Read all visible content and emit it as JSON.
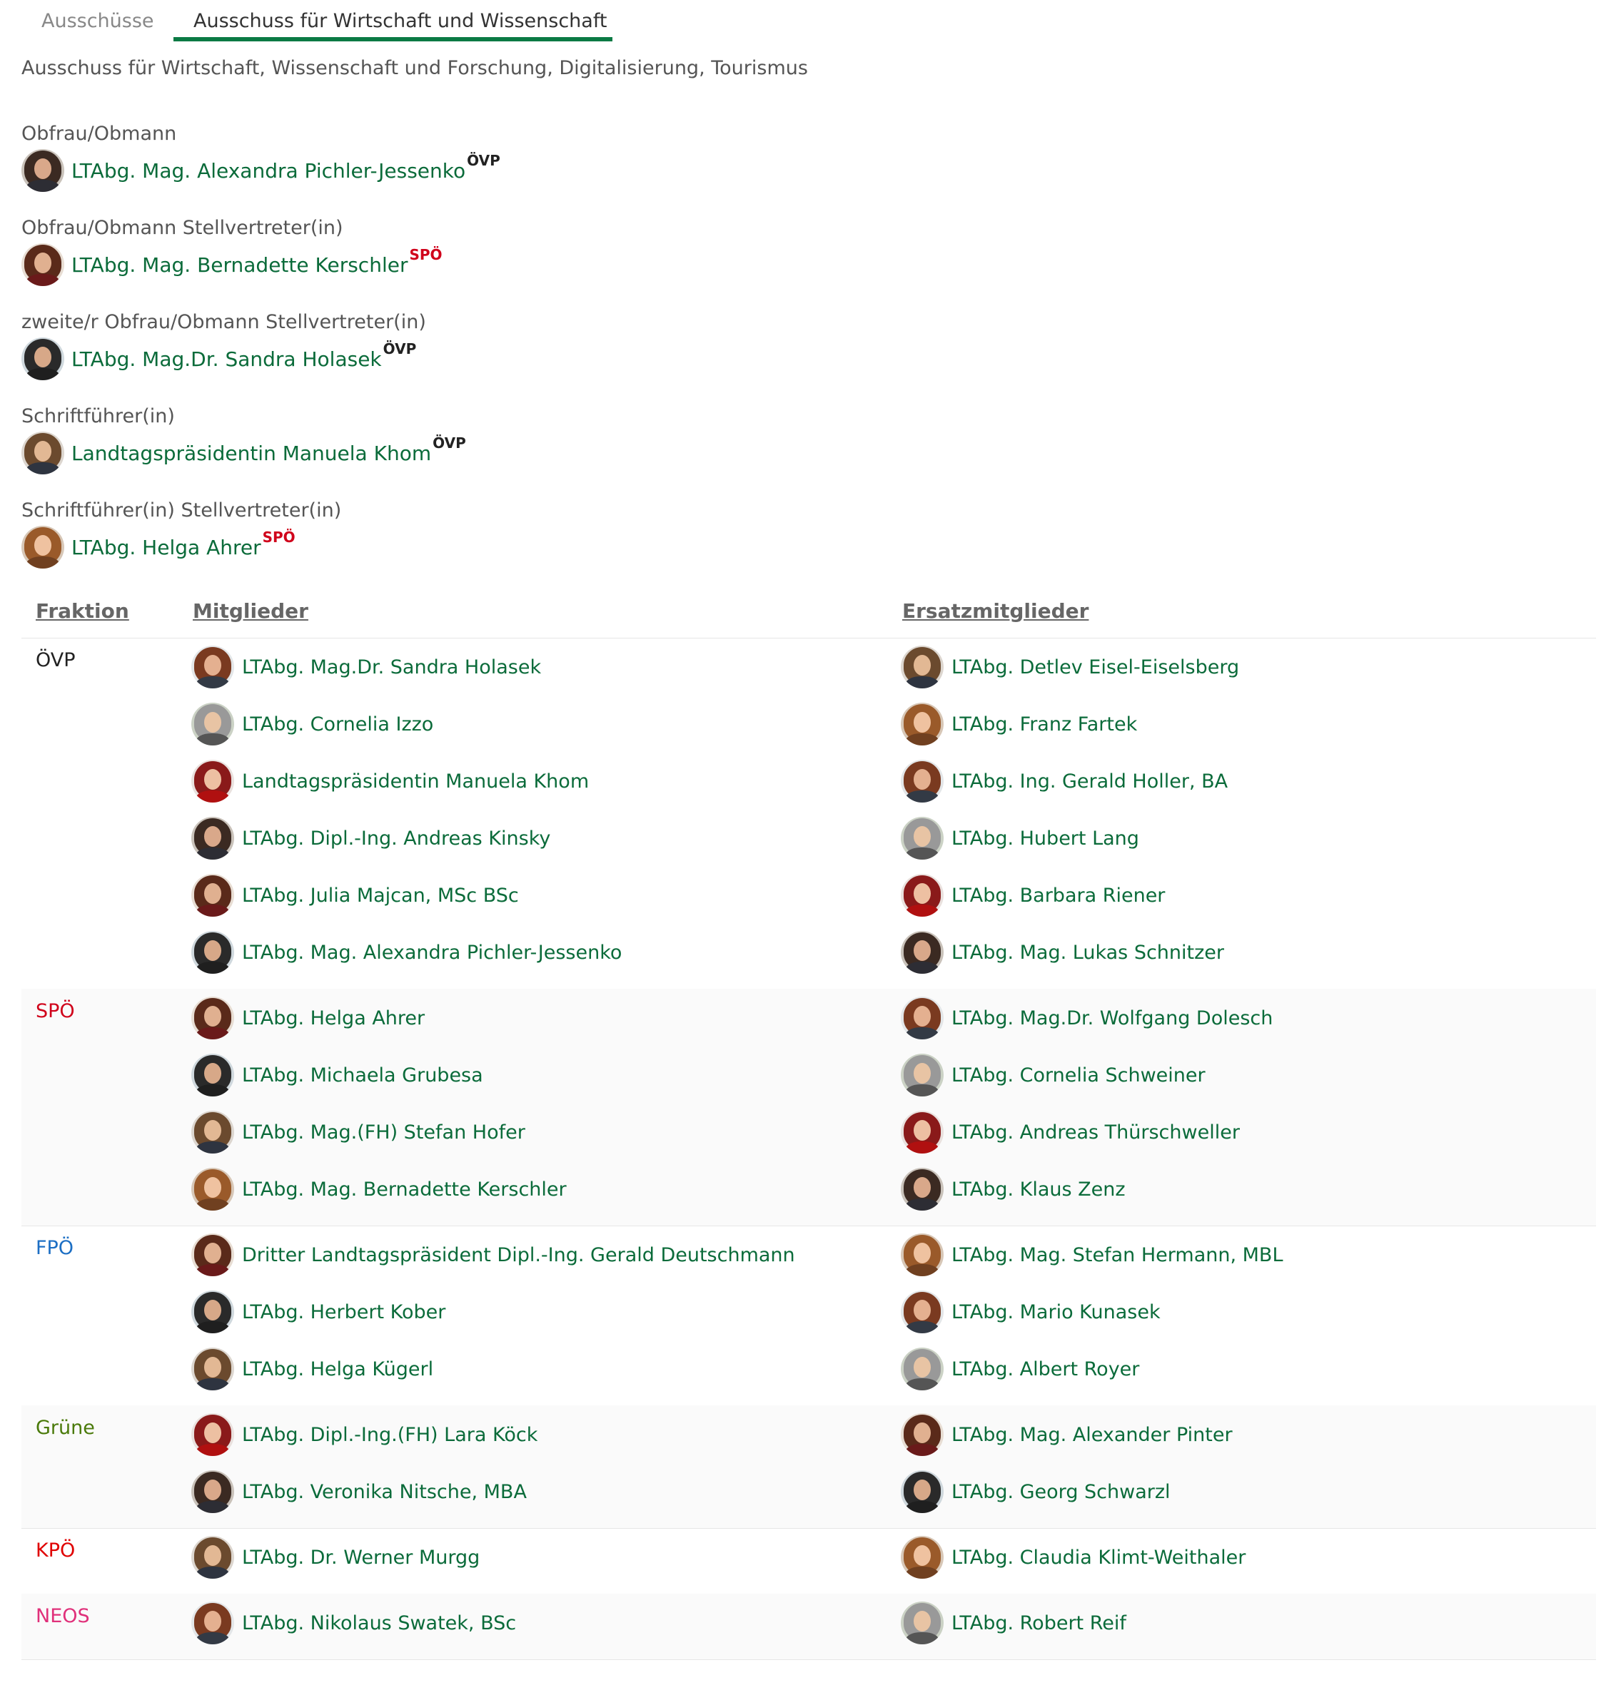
{
  "colors": {
    "accent": "#0a7a44",
    "link": "#0b6b3a",
    "ovp": "#222222",
    "spo": "#d0021b",
    "fpo": "#1d6fc4",
    "gruene": "#4a7a0a",
    "kpo": "#e00000",
    "neos": "#e0307a"
  },
  "tabs": [
    {
      "label": "Ausschüsse",
      "active": false
    },
    {
      "label": "Ausschuss für Wirtschaft und Wissenschaft",
      "active": true
    }
  ],
  "subtitle": "Ausschuss für Wirtschaft, Wissenschaft und Forschung, Digitalisierung, Tourismus",
  "roles": [
    {
      "title": "Obfrau/Obmann",
      "name": "LTAbg. Mag. Alexandra Pichler-Jessenko",
      "party": "ÖVP",
      "party_key": "ovp"
    },
    {
      "title": "Obfrau/Obmann Stellvertreter(in)",
      "name": "LTAbg. Mag. Bernadette Kerschler",
      "party": "SPÖ",
      "party_key": "spo"
    },
    {
      "title": "zweite/r Obfrau/Obmann Stellvertreter(in)",
      "name": "LTAbg. Mag.Dr. Sandra Holasek",
      "party": "ÖVP",
      "party_key": "ovp"
    },
    {
      "title": "Schriftführer(in)",
      "name": "Landtagspräsidentin Manuela Khom",
      "party": "ÖVP",
      "party_key": "ovp"
    },
    {
      "title": "Schriftführer(in) Stellvertreter(in)",
      "name": "LTAbg. Helga Ahrer",
      "party": "SPÖ",
      "party_key": "spo"
    }
  ],
  "table": {
    "headers": {
      "fraktion": "Fraktion",
      "mitglieder": "Mitglieder",
      "ersatzmitglieder": "Ersatzmitglieder"
    },
    "groups": [
      {
        "fraktion": "ÖVP",
        "party_key": "ovp",
        "members": [
          "LTAbg. Mag.Dr. Sandra Holasek",
          "LTAbg. Cornelia Izzo",
          "Landtagspräsidentin Manuela Khom",
          "LTAbg. Dipl.-Ing. Andreas Kinsky",
          "LTAbg. Julia Majcan, MSc BSc",
          "LTAbg. Mag. Alexandra Pichler-Jessenko"
        ],
        "substitutes": [
          "LTAbg. Detlev Eisel-Eiselsberg",
          "LTAbg. Franz Fartek",
          "LTAbg. Ing. Gerald Holler, BA",
          "LTAbg. Hubert Lang",
          "LTAbg. Barbara Riener",
          "LTAbg. Mag. Lukas Schnitzer"
        ]
      },
      {
        "fraktion": "SPÖ",
        "party_key": "spo",
        "members": [
          "LTAbg. Helga Ahrer",
          "LTAbg. Michaela Grubesa",
          "LTAbg. Mag.(FH) Stefan Hofer",
          "LTAbg. Mag. Bernadette Kerschler"
        ],
        "substitutes": [
          "LTAbg. Mag.Dr. Wolfgang Dolesch",
          "LTAbg. Cornelia Schweiner",
          "LTAbg. Andreas Thürschweller",
          "LTAbg. Klaus Zenz"
        ]
      },
      {
        "fraktion": "FPÖ",
        "party_key": "fpo",
        "members": [
          "Dritter Landtagspräsident Dipl.-Ing. Gerald Deutschmann",
          "LTAbg. Herbert Kober",
          "LTAbg. Helga Kügerl"
        ],
        "substitutes": [
          "LTAbg. Mag. Stefan Hermann, MBL",
          "LTAbg. Mario Kunasek",
          "LTAbg. Albert Royer"
        ]
      },
      {
        "fraktion": "Grüne",
        "party_key": "gruene",
        "members": [
          "LTAbg. Dipl.-Ing.(FH) Lara Köck",
          "LTAbg. Veronika Nitsche, MBA"
        ],
        "substitutes": [
          "LTAbg. Mag. Alexander Pinter",
          "LTAbg. Georg Schwarzl"
        ]
      },
      {
        "fraktion": "KPÖ",
        "party_key": "kpo",
        "members": [
          "LTAbg. Dr. Werner Murgg"
        ],
        "substitutes": [
          "LTAbg. Claudia Klimt-Weithaler"
        ]
      },
      {
        "fraktion": "NEOS",
        "party_key": "neos",
        "members": [
          "LTAbg. Nikolaus Swatek, BSc"
        ],
        "substitutes": [
          "LTAbg. Robert Reif"
        ]
      }
    ]
  }
}
